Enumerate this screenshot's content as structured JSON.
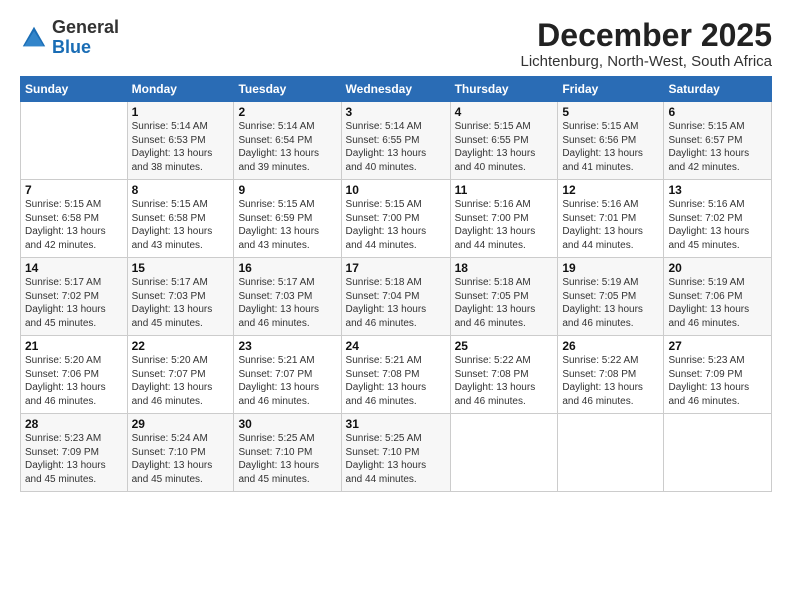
{
  "header": {
    "logo_general": "General",
    "logo_blue": "Blue",
    "title": "December 2025",
    "location": "Lichtenburg, North-West, South Africa"
  },
  "weekdays": [
    "Sunday",
    "Monday",
    "Tuesday",
    "Wednesday",
    "Thursday",
    "Friday",
    "Saturday"
  ],
  "weeks": [
    [
      {
        "day": "",
        "info": ""
      },
      {
        "day": "1",
        "info": "Sunrise: 5:14 AM\nSunset: 6:53 PM\nDaylight: 13 hours\nand 38 minutes."
      },
      {
        "day": "2",
        "info": "Sunrise: 5:14 AM\nSunset: 6:54 PM\nDaylight: 13 hours\nand 39 minutes."
      },
      {
        "day": "3",
        "info": "Sunrise: 5:14 AM\nSunset: 6:55 PM\nDaylight: 13 hours\nand 40 minutes."
      },
      {
        "day": "4",
        "info": "Sunrise: 5:15 AM\nSunset: 6:55 PM\nDaylight: 13 hours\nand 40 minutes."
      },
      {
        "day": "5",
        "info": "Sunrise: 5:15 AM\nSunset: 6:56 PM\nDaylight: 13 hours\nand 41 minutes."
      },
      {
        "day": "6",
        "info": "Sunrise: 5:15 AM\nSunset: 6:57 PM\nDaylight: 13 hours\nand 42 minutes."
      }
    ],
    [
      {
        "day": "7",
        "info": "Sunrise: 5:15 AM\nSunset: 6:58 PM\nDaylight: 13 hours\nand 42 minutes."
      },
      {
        "day": "8",
        "info": "Sunrise: 5:15 AM\nSunset: 6:58 PM\nDaylight: 13 hours\nand 43 minutes."
      },
      {
        "day": "9",
        "info": "Sunrise: 5:15 AM\nSunset: 6:59 PM\nDaylight: 13 hours\nand 43 minutes."
      },
      {
        "day": "10",
        "info": "Sunrise: 5:15 AM\nSunset: 7:00 PM\nDaylight: 13 hours\nand 44 minutes."
      },
      {
        "day": "11",
        "info": "Sunrise: 5:16 AM\nSunset: 7:00 PM\nDaylight: 13 hours\nand 44 minutes."
      },
      {
        "day": "12",
        "info": "Sunrise: 5:16 AM\nSunset: 7:01 PM\nDaylight: 13 hours\nand 44 minutes."
      },
      {
        "day": "13",
        "info": "Sunrise: 5:16 AM\nSunset: 7:02 PM\nDaylight: 13 hours\nand 45 minutes."
      }
    ],
    [
      {
        "day": "14",
        "info": "Sunrise: 5:17 AM\nSunset: 7:02 PM\nDaylight: 13 hours\nand 45 minutes."
      },
      {
        "day": "15",
        "info": "Sunrise: 5:17 AM\nSunset: 7:03 PM\nDaylight: 13 hours\nand 45 minutes."
      },
      {
        "day": "16",
        "info": "Sunrise: 5:17 AM\nSunset: 7:03 PM\nDaylight: 13 hours\nand 46 minutes."
      },
      {
        "day": "17",
        "info": "Sunrise: 5:18 AM\nSunset: 7:04 PM\nDaylight: 13 hours\nand 46 minutes."
      },
      {
        "day": "18",
        "info": "Sunrise: 5:18 AM\nSunset: 7:05 PM\nDaylight: 13 hours\nand 46 minutes."
      },
      {
        "day": "19",
        "info": "Sunrise: 5:19 AM\nSunset: 7:05 PM\nDaylight: 13 hours\nand 46 minutes."
      },
      {
        "day": "20",
        "info": "Sunrise: 5:19 AM\nSunset: 7:06 PM\nDaylight: 13 hours\nand 46 minutes."
      }
    ],
    [
      {
        "day": "21",
        "info": "Sunrise: 5:20 AM\nSunset: 7:06 PM\nDaylight: 13 hours\nand 46 minutes."
      },
      {
        "day": "22",
        "info": "Sunrise: 5:20 AM\nSunset: 7:07 PM\nDaylight: 13 hours\nand 46 minutes."
      },
      {
        "day": "23",
        "info": "Sunrise: 5:21 AM\nSunset: 7:07 PM\nDaylight: 13 hours\nand 46 minutes."
      },
      {
        "day": "24",
        "info": "Sunrise: 5:21 AM\nSunset: 7:08 PM\nDaylight: 13 hours\nand 46 minutes."
      },
      {
        "day": "25",
        "info": "Sunrise: 5:22 AM\nSunset: 7:08 PM\nDaylight: 13 hours\nand 46 minutes."
      },
      {
        "day": "26",
        "info": "Sunrise: 5:22 AM\nSunset: 7:08 PM\nDaylight: 13 hours\nand 46 minutes."
      },
      {
        "day": "27",
        "info": "Sunrise: 5:23 AM\nSunset: 7:09 PM\nDaylight: 13 hours\nand 46 minutes."
      }
    ],
    [
      {
        "day": "28",
        "info": "Sunrise: 5:23 AM\nSunset: 7:09 PM\nDaylight: 13 hours\nand 45 minutes."
      },
      {
        "day": "29",
        "info": "Sunrise: 5:24 AM\nSunset: 7:10 PM\nDaylight: 13 hours\nand 45 minutes."
      },
      {
        "day": "30",
        "info": "Sunrise: 5:25 AM\nSunset: 7:10 PM\nDaylight: 13 hours\nand 45 minutes."
      },
      {
        "day": "31",
        "info": "Sunrise: 5:25 AM\nSunset: 7:10 PM\nDaylight: 13 hours\nand 44 minutes."
      },
      {
        "day": "",
        "info": ""
      },
      {
        "day": "",
        "info": ""
      },
      {
        "day": "",
        "info": ""
      }
    ]
  ]
}
